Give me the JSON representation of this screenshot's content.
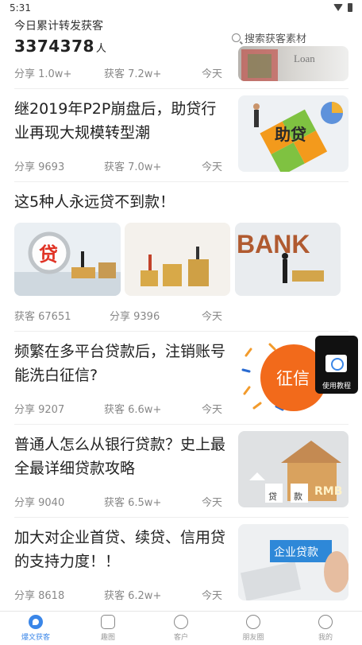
{
  "status": {
    "time": "5:31"
  },
  "header": {
    "subtitle": "今日累计转发获客",
    "count": "3374378",
    "unit": "人",
    "search_placeholder": "搜索获客素材"
  },
  "articles": [
    {
      "title": "",
      "m1": "分享 1.0w+",
      "m2": "获客 7.2w+",
      "m3": "今天"
    },
    {
      "title": "继2019年P2P崩盘后，助贷行业再现大规模转型潮",
      "m1": "分享 9693",
      "m2": "获客 7.0w+",
      "m3": "今天"
    },
    {
      "title": "这5种人永远贷不到款！",
      "m1": "获客 67651",
      "m2": "分享 9396",
      "m3": "今天"
    },
    {
      "title": "频繁在多平台贷款后，注销账号能洗白征信?",
      "m1": "分享 9207",
      "m2": "获客 6.6w+",
      "m3": "今天"
    },
    {
      "title": "普通人怎么从银行贷款？史上最全最详细贷款攻略",
      "m1": "分享 9040",
      "m2": "获客 6.5w+",
      "m3": "今天"
    },
    {
      "title": "加大对企业首贷、续贷、信用贷的支持力度！！",
      "m1": "分享 8618",
      "m2": "获客 6.2w+",
      "m3": "今天"
    }
  ],
  "image_text": {
    "loan_partial": "Loan",
    "zhudai": "助贷",
    "dai": "贷",
    "bank": "BANK",
    "zhengxin": "征信",
    "dai2": "贷",
    "kuan": "款",
    "rmb": "RMB",
    "qiye": "企业贷款"
  },
  "float_button": {
    "label": "使用教程"
  },
  "tabs": [
    {
      "label": "爆文获客"
    },
    {
      "label": "趣图"
    },
    {
      "label": "客户"
    },
    {
      "label": "朋友圈"
    },
    {
      "label": "我的"
    }
  ],
  "colors": {
    "accent": "#3a86e8",
    "orange": "#f26a1b"
  }
}
